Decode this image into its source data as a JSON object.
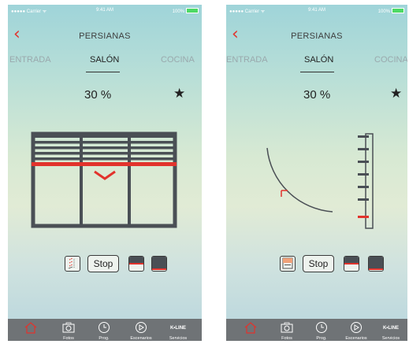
{
  "screens": [
    {
      "status": {
        "carrier": "●●●●● Carrier ᯤ",
        "time": "9:41 AM",
        "battery": "100%"
      },
      "title": "PERSIANAS",
      "tabs": [
        "ENTRADA",
        "SALÓN",
        "COCINA"
      ],
      "active_tab": "SALÓN",
      "percent": "30 %",
      "controls": {
        "stop_label": "Stop"
      },
      "tabbar": [
        {
          "label": "",
          "icon": "home-icon"
        },
        {
          "label": "Fotos",
          "icon": "camera-icon"
        },
        {
          "label": "Prog.",
          "icon": "clock-icon"
        },
        {
          "label": "Escenarios",
          "icon": "play-icon"
        },
        {
          "label": "Servicios",
          "icon": "kline-logo",
          "logo_text": "K•LINE"
        }
      ]
    },
    {
      "status": {
        "carrier": "●●●●● Carrier ᯤ",
        "time": "9:41 AM",
        "battery": "100%"
      },
      "title": "PERSIANAS",
      "tabs": [
        "ENTRADA",
        "SALÓN",
        "COCINA"
      ],
      "active_tab": "SALÓN",
      "percent": "30 %",
      "controls": {
        "stop_label": "Stop"
      },
      "tabbar": [
        {
          "label": "",
          "icon": "home-icon"
        },
        {
          "label": "Fotos",
          "icon": "camera-icon"
        },
        {
          "label": "Prog.",
          "icon": "clock-icon"
        },
        {
          "label": "Escenarios",
          "icon": "play-icon"
        },
        {
          "label": "Servicios",
          "icon": "kline-logo",
          "logo_text": "K•LINE"
        }
      ]
    }
  ],
  "colors": {
    "accent": "#e2332c",
    "dark": "#4a4f55",
    "tabbar": "#6f7376"
  }
}
